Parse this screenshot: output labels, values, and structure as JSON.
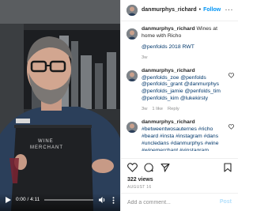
{
  "video": {
    "time_label": "0:00 / 4:11",
    "progress": 0.0,
    "apron_text_top": "WINE",
    "apron_text_bottom": "MERCHANT"
  },
  "header": {
    "username": "danmurphys_richard",
    "separator": "•",
    "follow_label": "Follow",
    "more_label": "···"
  },
  "comments": [
    {
      "user": "danmurphys_richard",
      "text": " Wines at home with Richo",
      "tags": "@penfolds 2018 RWT",
      "time": "3w",
      "likes": "",
      "reply": ""
    },
    {
      "user": "danmurphys_richard",
      "text": "",
      "tags": "@penfolds_zoe @penfolds @penfolds_grant @danmurphys @penfolds_jamie @penfolds_tim @penfolds_kim @lukekirsty",
      "time": "3w",
      "likes": "1 like",
      "reply": "Reply"
    },
    {
      "user": "danmurphys_richard",
      "text": "",
      "tags": "#betweentwosauternes #richo #beard #insta #instagram #dans #uncledans #danmurphys #wine #winemerchant #vinstagram",
      "time": "",
      "likes": "",
      "reply": ""
    }
  ],
  "likes_label": "322 views",
  "date_label": "AUGUST 16",
  "add_comment": {
    "placeholder": "Add a comment...",
    "post_label": "Post"
  },
  "colors": {
    "link": "#0095f6",
    "tag": "#00376b",
    "muted": "#8e8e8e"
  }
}
